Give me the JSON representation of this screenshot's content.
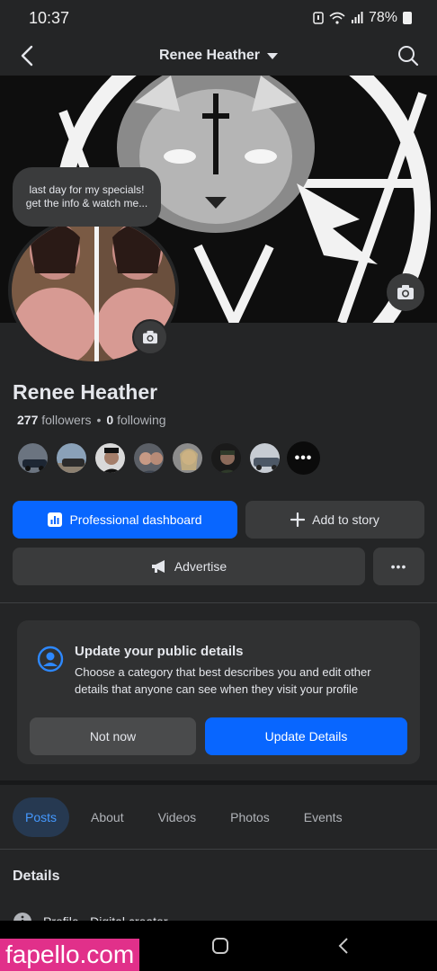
{
  "status_bar": {
    "time": "10:37",
    "battery": "78%"
  },
  "header": {
    "title": "Renee Heather"
  },
  "note": {
    "line1": "last day for my specials!",
    "line2": "get the info & watch me..."
  },
  "profile": {
    "name": "Renee Heather",
    "followers_count": "277",
    "followers_label": "followers",
    "separator": "•",
    "following_count": "0",
    "following_label": "following"
  },
  "follower_avatars": [
    {
      "icon": "car-photo"
    },
    {
      "icon": "car-photo"
    },
    {
      "icon": "person-photo"
    },
    {
      "icon": "person-photo"
    },
    {
      "icon": "person-photo"
    },
    {
      "icon": "person-photo"
    },
    {
      "icon": "car-photo"
    }
  ],
  "more_followers": "•••",
  "actions": {
    "professional_dashboard": "Professional dashboard",
    "add_to_story": "Add to story",
    "advertise": "Advertise",
    "more": "•••"
  },
  "details_card": {
    "title": "Update your public details",
    "body": "Choose a category that best describes you and edit other details that anyone can see when they visit your profile",
    "not_now": "Not now",
    "update": "Update Details"
  },
  "tabs": [
    {
      "label": "Posts",
      "active": true
    },
    {
      "label": "About",
      "active": false
    },
    {
      "label": "Videos",
      "active": false
    },
    {
      "label": "Photos",
      "active": false
    },
    {
      "label": "Events",
      "active": false
    }
  ],
  "details_section": {
    "heading": "Details",
    "partial_row": "Profile · Digital creator"
  },
  "watermark": "fapello.com",
  "colors": {
    "primary": "#0866ff",
    "background": "#242526",
    "surface": "#3a3b3c",
    "active_tab_bg": "#263951",
    "active_tab_text": "#4599ff"
  }
}
